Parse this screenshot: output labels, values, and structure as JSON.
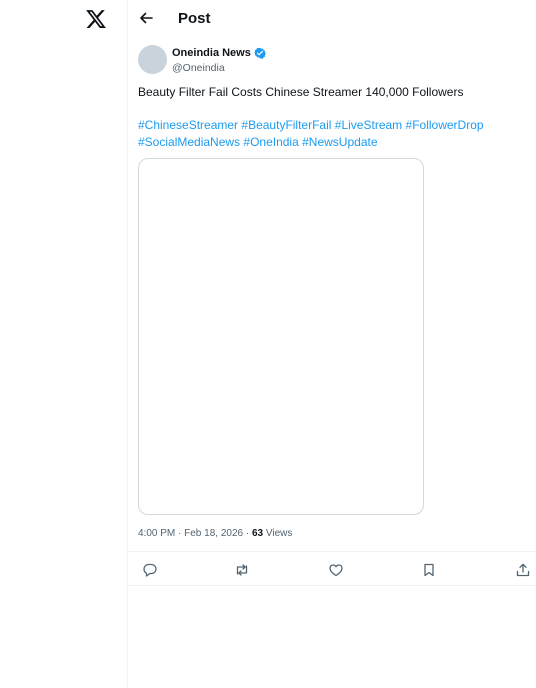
{
  "header": {
    "title": "Post"
  },
  "post": {
    "author": {
      "name": "Oneindia News",
      "handle": "@Oneindia",
      "verified": true
    },
    "text": "Beauty Filter Fail Costs Chinese Streamer 140,000 Followers",
    "hashtags_line1": [
      "#ChineseStreamer",
      "#BeautyFilterFail",
      "#LiveStream",
      "#FollowerDrop"
    ],
    "hashtags_line2": [
      "#SocialMediaNews",
      "#OneIndia",
      "#NewsUpdate"
    ],
    "timestamp": "4:00 PM · Feb 18, 2026 · ",
    "views_count": "63",
    "views_label": " Views"
  },
  "actions": [
    "reply-icon",
    "repost-icon",
    "like-icon",
    "bookmark-icon",
    "share-icon"
  ],
  "colors": {
    "link": "#1d9bf0",
    "text": "#0f1419",
    "secondary": "#536471",
    "verified": "#1d9bf0",
    "avatar": "#c9d3dc"
  }
}
